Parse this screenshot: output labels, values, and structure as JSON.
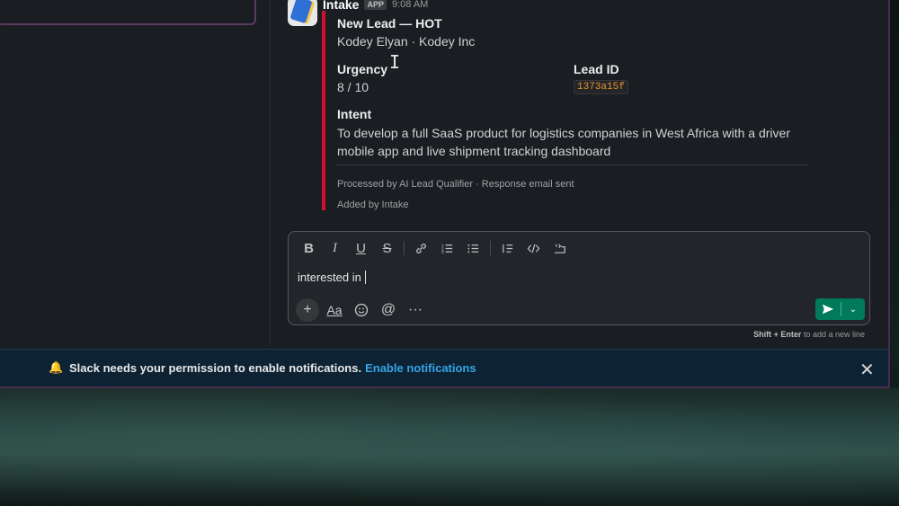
{
  "message": {
    "sender": "Intake",
    "badge": "APP",
    "time": "9:08 AM",
    "title": "New Lead — HOT",
    "subtitle": "Kodey Elyan · Kodey Inc",
    "fields": {
      "urgency_label": "Urgency",
      "urgency_value": "8 / 10",
      "lead_id_label": "Lead ID",
      "lead_id_value": "1373a15f",
      "intent_label": "Intent",
      "intent_value": "To develop a full SaaS product for logistics companies in West Africa with a driver mobile app and live shipment tracking dashboard"
    },
    "footer": "Processed by AI Lead Qualifier · Response email sent",
    "added_by": "Added by Intake",
    "accent_color": "#d01030"
  },
  "composer": {
    "text": "interested in ",
    "hint_key": "Shift + Enter",
    "hint_rest": " to add a new line",
    "toolbar_icons": [
      "bold-icon",
      "italic-icon",
      "underline-icon",
      "strikethrough-icon",
      "link-icon",
      "ordered-list-icon",
      "bulleted-list-icon",
      "blockquote-icon",
      "code-icon",
      "code-block-icon"
    ],
    "bottom_icons": [
      "plus-icon",
      "formatting-icon",
      "emoji-icon",
      "mention-icon",
      "more-icon"
    ],
    "formatting_label": "Aa",
    "send_color": "#007a5a"
  },
  "banner": {
    "text": "Slack needs your permission to enable notifications.",
    "link": "Enable notifications",
    "link_color": "#36a4e6"
  }
}
